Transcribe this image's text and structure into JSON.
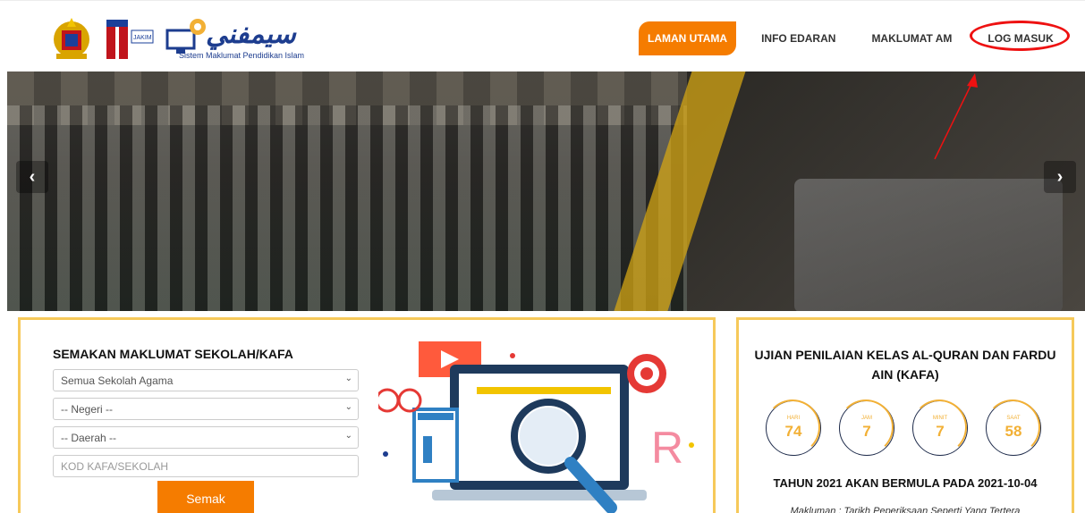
{
  "header": {
    "brand_arabic": "سيمفني",
    "brand_subtitle": "Sistem Maklumat Pendidikan Islam",
    "jakim_label": "JAKIM",
    "nav": [
      {
        "label": "LAMAN UTAMA",
        "active": true
      },
      {
        "label": "INFO EDARAN",
        "active": false
      },
      {
        "label": "MAKLUMAT AM",
        "active": false
      },
      {
        "label": "LOG MASUK",
        "active": false
      }
    ],
    "colors": {
      "accent": "#f57c00",
      "brand": "#1d3d8f",
      "highlight": "#e11111"
    }
  },
  "hero": {
    "prev_icon": "chevron-left-icon",
    "next_icon": "chevron-right-icon",
    "prev_glyph": "‹",
    "next_glyph": "›"
  },
  "search": {
    "title": "SEMAKAN MAKLUMAT SEKOLAH/KAFA",
    "school_type": "Semua Sekolah Agama",
    "state": "-- Negeri --",
    "district": "-- Daerah --",
    "code_placeholder": "KOD KAFA/SEKOLAH",
    "submit_label": "Semak"
  },
  "exam": {
    "title": "UJIAN PENILAIAN KELAS AL-QURAN DAN FARDU AIN (KAFA)",
    "countdown": [
      {
        "label": "HARI",
        "value": "74"
      },
      {
        "label": "JAM",
        "value": "7"
      },
      {
        "label": "MINIT",
        "value": "7"
      },
      {
        "label": "SAAT",
        "value": "58"
      }
    ],
    "start_text": "TAHUN 2021 AKAN BERMULA PADA 2021-10-04",
    "note": "Makluman : Tarikh Peperiksaan Seperti Yang Tertera"
  }
}
